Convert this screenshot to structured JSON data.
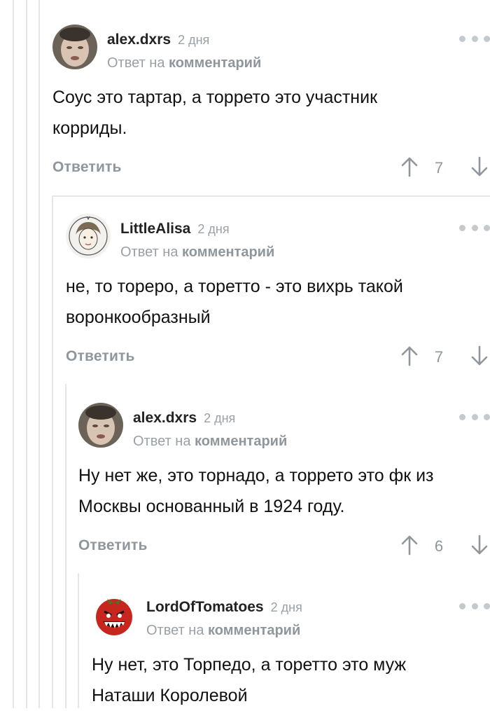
{
  "comments": [
    {
      "username": "alex.dxrs",
      "time": "2 дня",
      "reply_prefix": "Ответ на",
      "reply_link": "комментарий",
      "text_lines": [
        "Соус это тартар, а торрето это участник",
        "корриды."
      ],
      "reply_label": "Ответить",
      "score": "7",
      "avatar": "face-photo"
    },
    {
      "username": "LittleAlisa",
      "time": "2 дня",
      "reply_prefix": "Ответ на",
      "reply_link": "комментарий",
      "text_lines": [
        "не, то тореро, а торетто - это вихрь такой",
        "воронкообразный"
      ],
      "reply_label": "Ответить",
      "score": "7",
      "avatar": "sketch-girl"
    },
    {
      "username": "alex.dxrs",
      "time": "2 дня",
      "reply_prefix": "Ответ на",
      "reply_link": "комментарий",
      "text_lines": [
        "Ну нет же, это торнадо, а торрето это фк из",
        "Москвы основанный в 1924 году."
      ],
      "reply_label": "Ответить",
      "score": "6",
      "avatar": "face-photo"
    },
    {
      "username": "LordOfTomatoes",
      "time": "2 дня",
      "reply_prefix": "Ответ на",
      "reply_link": "комментарий",
      "text_lines": [
        "Ну нет, это Торпедо, а торетто это муж",
        "Наташи Королевой"
      ],
      "avatar": "angry-tomato"
    }
  ],
  "icons": {
    "more": "more-dots-icon",
    "upvote": "arrow-up-icon",
    "downvote": "arrow-down-icon"
  },
  "colors": {
    "muted": "#8f969c",
    "thread_line": "#e4e6e8",
    "text": "#111111"
  }
}
